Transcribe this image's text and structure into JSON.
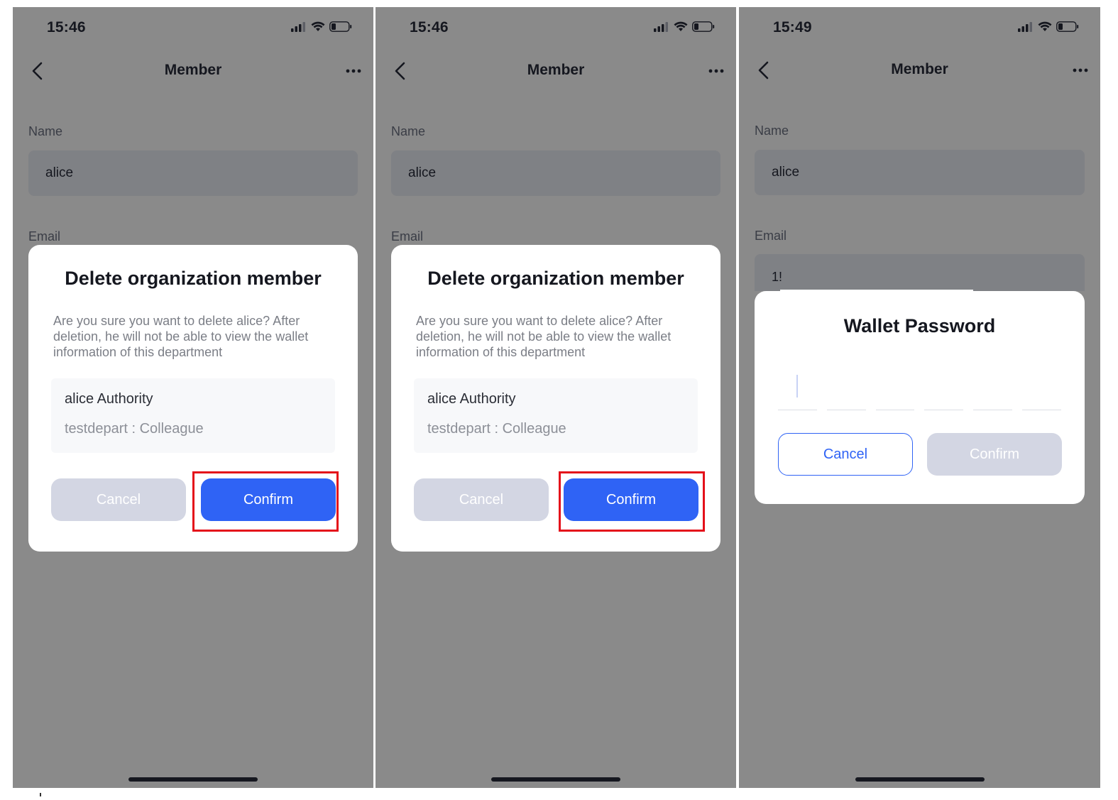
{
  "screens": [
    {
      "status": {
        "time": "15:46"
      },
      "nav": {
        "title": "Member"
      },
      "form": {
        "name_label": "Name",
        "name_value": "alice",
        "email_label": "Email"
      },
      "dialog": {
        "title": "Delete organization member",
        "description": "Are you sure you want to delete alice? After deletion, he will not be able to view the wallet information of this department",
        "authority_title": "alice Authority",
        "authority_role": "testdepart : Colleague",
        "cancel_label": "Cancel",
        "confirm_label": "Confirm"
      }
    },
    {
      "status": {
        "time": "15:46"
      },
      "nav": {
        "title": "Member"
      },
      "form": {
        "name_label": "Name",
        "name_value": "alice",
        "email_label": "Email"
      },
      "dialog": {
        "title": "Delete organization member",
        "description": "Are you sure you want to delete alice? After deletion, he will not be able to view the wallet information of this department",
        "authority_title": "alice Authority",
        "authority_role": "testdepart : Colleague",
        "cancel_label": "Cancel",
        "confirm_label": "Confirm"
      }
    },
    {
      "status": {
        "time": "15:49"
      },
      "nav": {
        "title": "Member"
      },
      "form": {
        "name_label": "Name",
        "name_value": "alice",
        "email_label": "Email",
        "email_value_partial": "1!"
      },
      "dialog": {
        "title": "Wallet Password",
        "cancel_label": "Cancel",
        "confirm_label": "Confirm"
      }
    }
  ],
  "icons": {
    "signal": "cellular-signal-icon",
    "wifi": "wifi-icon",
    "battery": "battery-low-icon",
    "back": "chevron-left-icon",
    "more": "more-dots-icon"
  },
  "colors": {
    "overlay": "#8a8a8a",
    "primary": "#2f63f5",
    "disabled": "#d3d6e3",
    "highlight": "#e4101a"
  }
}
